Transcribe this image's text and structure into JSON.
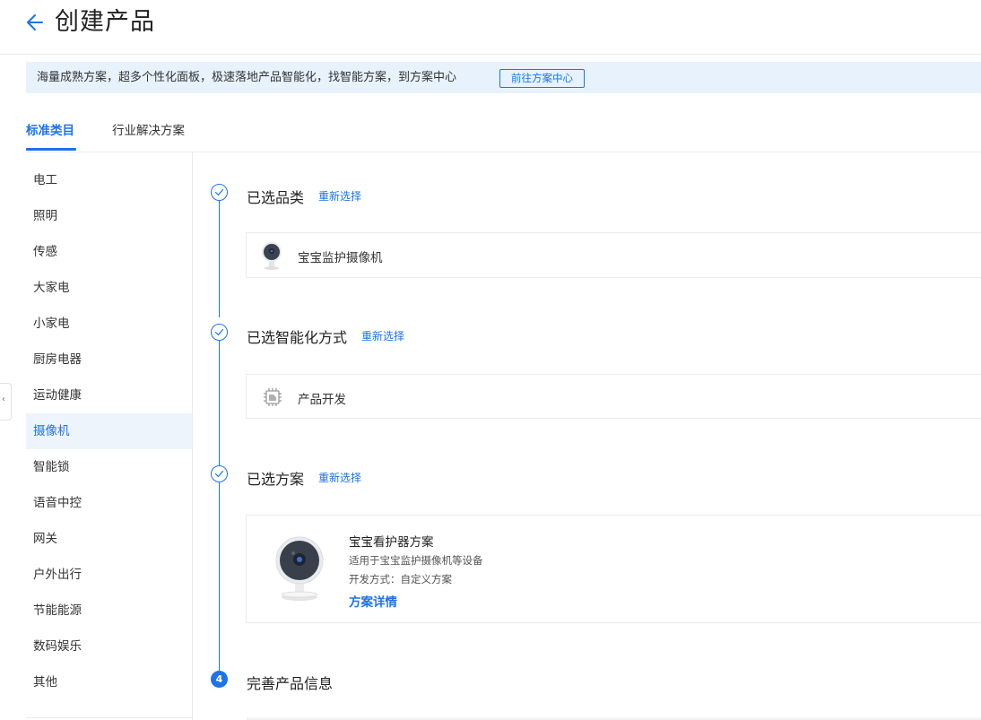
{
  "header": {
    "title": "创建产品"
  },
  "banner": {
    "text": "海量成熟方案，超多个性化面板，极速落地产品智能化，找智能方案，到方案中心",
    "button_label": "前往方案中心"
  },
  "tabs": [
    {
      "label": "标准类目",
      "active": true
    },
    {
      "label": "行业解决方案",
      "active": false
    }
  ],
  "sidebar": {
    "items": [
      {
        "label": "电工"
      },
      {
        "label": "照明"
      },
      {
        "label": "传感"
      },
      {
        "label": "大家电"
      },
      {
        "label": "小家电"
      },
      {
        "label": "厨房电器"
      },
      {
        "label": "运动健康"
      },
      {
        "label": "摄像机",
        "active": true
      },
      {
        "label": "智能锁"
      },
      {
        "label": "语音中控"
      },
      {
        "label": "网关"
      },
      {
        "label": "户外出行"
      },
      {
        "label": "节能能源"
      },
      {
        "label": "数码娱乐"
      },
      {
        "label": "其他"
      }
    ]
  },
  "steps": [
    {
      "title": "已选品类",
      "reselect": "重新选择",
      "card_text": "宝宝监护摄像机",
      "icon": "camera-icon"
    },
    {
      "title": "已选智能化方式",
      "reselect": "重新选择",
      "card_text": "产品开发",
      "icon": "chip-icon"
    },
    {
      "title": "已选方案",
      "reselect": "重新选择",
      "plan": {
        "name": "宝宝看护器方案",
        "desc": "适用于宝宝监护摄像机等设备",
        "mode": "开发方式：自定义方案",
        "link": "方案详情"
      }
    },
    {
      "title": "完善产品信息",
      "number": "4"
    }
  ],
  "colors": {
    "accent": "#1d73e8",
    "banner_bg": "#e7f2fd",
    "active_bg": "#eef4fc"
  }
}
